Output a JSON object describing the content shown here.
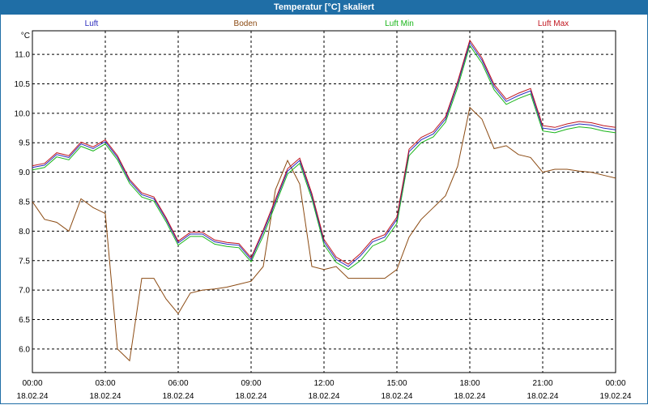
{
  "window": {
    "title": "Temperatur [°C] skaliert"
  },
  "legend": [
    {
      "label": "Luft",
      "color": "#2b2bbd"
    },
    {
      "label": "Boden",
      "color": "#8b4a12"
    },
    {
      "label": "Luft Min",
      "color": "#19b519"
    },
    {
      "label": "Luft Max",
      "color": "#c0151e"
    }
  ],
  "chart_data": {
    "type": "line",
    "title": "Temperatur [°C] skaliert",
    "ylabel": "°C",
    "ylim": [
      5.6,
      11.4
    ],
    "xlim": [
      0,
      24
    ],
    "grid": true,
    "legend_position": "top",
    "y_ticks": [
      "6.0",
      "6.5",
      "7.0",
      "7.5",
      "8.0",
      "8.5",
      "9.0",
      "9.5",
      "10.0",
      "10.5",
      "11.0"
    ],
    "x_ticks": [
      {
        "time": "00:00",
        "date": "18.02.24"
      },
      {
        "time": "03:00",
        "date": "18.02.24"
      },
      {
        "time": "06:00",
        "date": "18.02.24"
      },
      {
        "time": "09:00",
        "date": "18.02.24"
      },
      {
        "time": "12:00",
        "date": "18.02.24"
      },
      {
        "time": "15:00",
        "date": "18.02.24"
      },
      {
        "time": "18:00",
        "date": "18.02.24"
      },
      {
        "time": "21:00",
        "date": "18.02.24"
      },
      {
        "time": "00:00",
        "date": "19.02.24"
      }
    ],
    "x_hours": [
      0,
      0.5,
      1.0,
      1.5,
      2.0,
      2.5,
      3.0,
      3.5,
      4.0,
      4.5,
      5.0,
      5.5,
      6.0,
      6.5,
      7.0,
      7.5,
      8.0,
      8.5,
      9.0,
      9.5,
      10.0,
      10.5,
      11.0,
      11.5,
      12.0,
      12.5,
      13.0,
      13.5,
      14.0,
      14.5,
      15.0,
      15.5,
      16.0,
      16.5,
      17.0,
      17.5,
      18.0,
      18.5,
      19.0,
      19.5,
      20.0,
      20.5,
      21.0,
      21.5,
      22.0,
      22.5,
      23.0,
      23.5,
      24.0
    ],
    "series": [
      {
        "name": "Luft",
        "color": "#2b2bbd",
        "values": [
          9.08,
          9.12,
          9.3,
          9.25,
          9.48,
          9.4,
          9.52,
          9.25,
          8.85,
          8.62,
          8.55,
          8.2,
          7.8,
          7.95,
          7.95,
          7.82,
          7.78,
          7.76,
          7.52,
          7.98,
          8.5,
          9.02,
          9.2,
          8.6,
          7.82,
          7.52,
          7.4,
          7.58,
          7.82,
          7.9,
          8.2,
          9.35,
          9.55,
          9.65,
          9.9,
          10.5,
          11.2,
          10.9,
          10.45,
          10.2,
          10.3,
          10.38,
          9.75,
          9.72,
          9.78,
          9.82,
          9.8,
          9.75,
          9.72
        ]
      },
      {
        "name": "Boden",
        "color": "#8b4a12",
        "values": [
          8.5,
          8.2,
          8.15,
          8.0,
          8.55,
          8.4,
          8.3,
          6.0,
          5.8,
          7.2,
          7.2,
          6.85,
          6.6,
          6.95,
          7.0,
          7.02,
          7.05,
          7.1,
          7.15,
          7.4,
          8.7,
          9.2,
          8.8,
          7.4,
          7.35,
          7.4,
          7.2,
          7.2,
          7.2,
          7.2,
          7.35,
          7.9,
          8.2,
          8.4,
          8.6,
          9.1,
          10.1,
          9.9,
          9.4,
          9.45,
          9.3,
          9.25,
          9.0,
          9.05,
          9.05,
          9.02,
          9.0,
          8.95,
          8.9
        ]
      },
      {
        "name": "Luft Min",
        "color": "#19b519",
        "values": [
          9.04,
          9.08,
          9.26,
          9.21,
          9.44,
          9.36,
          9.48,
          9.21,
          8.81,
          8.58,
          8.51,
          8.16,
          7.76,
          7.91,
          7.91,
          7.78,
          7.74,
          7.72,
          7.48,
          7.92,
          8.45,
          8.97,
          9.15,
          8.55,
          7.77,
          7.47,
          7.35,
          7.5,
          7.75,
          7.84,
          8.13,
          9.28,
          9.5,
          9.6,
          9.85,
          10.44,
          11.15,
          10.85,
          10.4,
          10.15,
          10.25,
          10.33,
          9.7,
          9.67,
          9.73,
          9.77,
          9.75,
          9.7,
          9.67
        ]
      },
      {
        "name": "Luft Max",
        "color": "#c0151e",
        "values": [
          9.11,
          9.15,
          9.33,
          9.28,
          9.51,
          9.43,
          9.55,
          9.28,
          8.88,
          8.65,
          8.58,
          8.23,
          7.83,
          7.98,
          7.98,
          7.85,
          7.81,
          7.79,
          7.55,
          8.02,
          8.54,
          9.06,
          9.24,
          8.64,
          7.86,
          7.56,
          7.44,
          7.62,
          7.86,
          7.94,
          8.24,
          9.39,
          9.59,
          9.69,
          9.94,
          10.54,
          11.24,
          10.94,
          10.49,
          10.24,
          10.34,
          10.42,
          9.79,
          9.76,
          9.82,
          9.86,
          9.84,
          9.79,
          9.76
        ]
      }
    ]
  }
}
